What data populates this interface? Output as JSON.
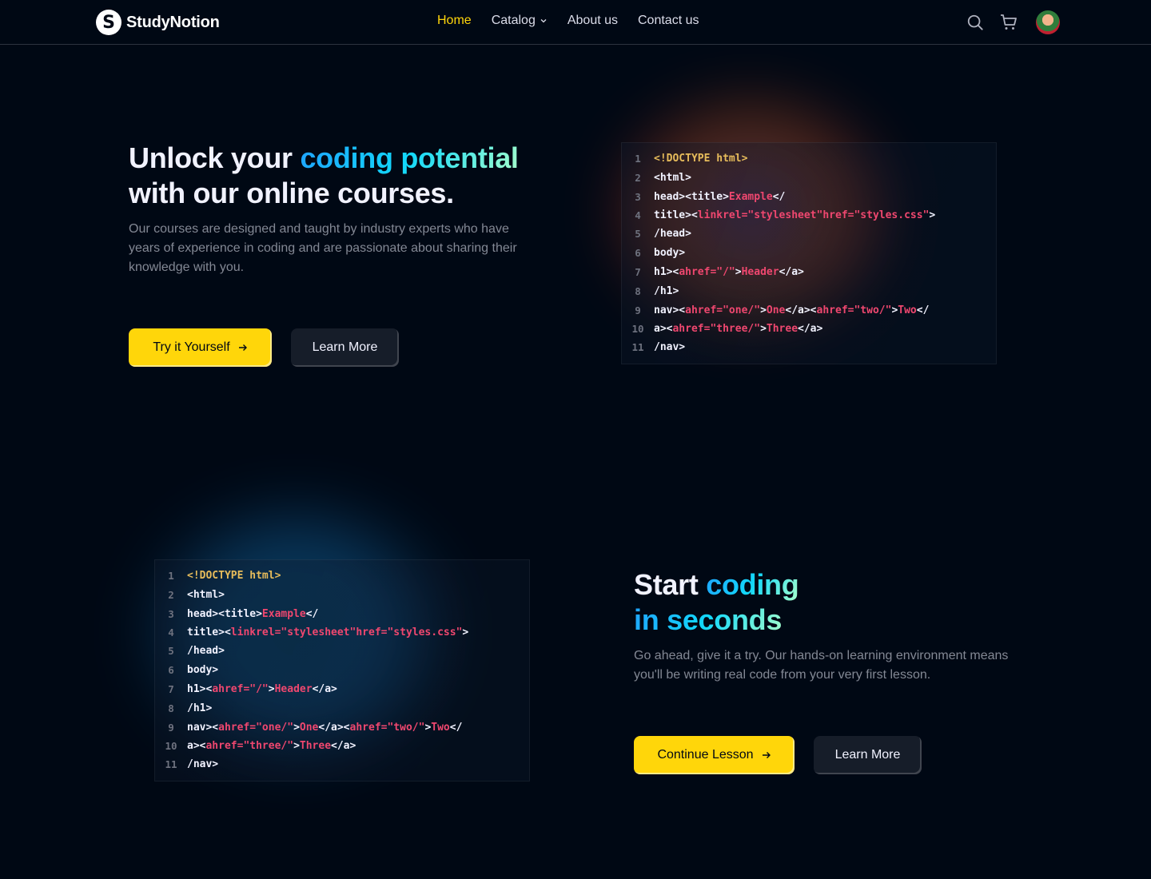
{
  "nav": {
    "brand": "StudyNotion",
    "brand_mark": "S",
    "links": [
      {
        "label": "Home",
        "active": true
      },
      {
        "label": "Catalog",
        "has_dropdown": true
      },
      {
        "label": "About us"
      },
      {
        "label": "Contact us"
      }
    ],
    "icons": [
      "search-icon",
      "cart-icon",
      "avatar"
    ]
  },
  "section1": {
    "heading_pre": "Unlock your ",
    "heading_highlight": "coding potential",
    "heading_post": "with our online courses.",
    "subheading": "Our courses are designed and taught by industry experts who have years of experience in coding and are passionate about sharing their knowledge with you.",
    "btn_primary": "Try it Yourself",
    "btn_secondary": "Learn More"
  },
  "section2": {
    "heading_pre": "Start ",
    "heading_highlight_1": "coding",
    "heading_highlight_2": "in seconds",
    "subheading": "Go ahead, give it a try. Our hands-on learning environment means you'll be writing real code from your very first lesson.",
    "btn_primary": "Continue Lesson",
    "btn_secondary": "Learn More"
  },
  "code": {
    "line_numbers": [
      "1",
      "2",
      "3",
      "4",
      "5",
      "6",
      "7",
      "8",
      "9",
      "10",
      "11"
    ],
    "lines": [
      "<!DOCTYPE html>",
      "<html>",
      "head><title>Example</",
      "title><linkrel=\"stylesheet\"href=\"styles.css\">",
      "/head>",
      "body>",
      "h1><ahref=\"/\">Header</a>",
      "/h1>",
      "nav><ahref=\"one/\">One</a><ahref=\"two/\">Two</",
      "a><ahref=\"three/\">Three</a>",
      "/nav>"
    ]
  },
  "colors": {
    "accent_yellow": "#ffd60a",
    "background": "#000814",
    "code_string": "#ef476f",
    "code_doctype": "#e7bc5b"
  }
}
